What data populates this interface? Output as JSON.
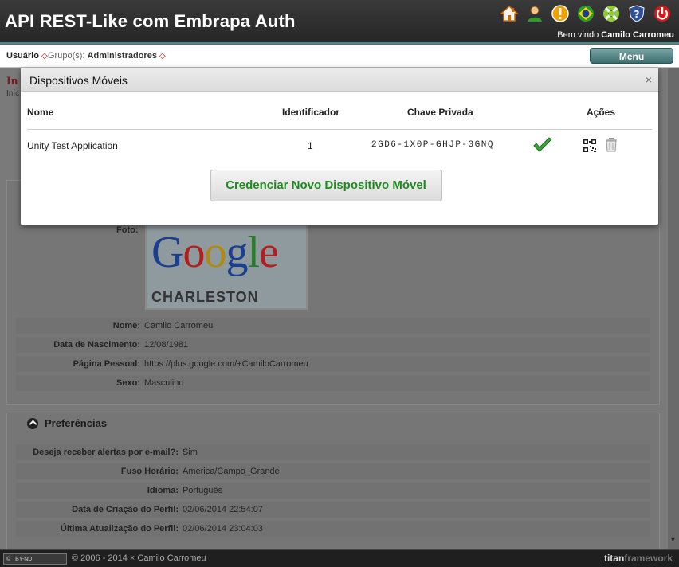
{
  "header": {
    "app_title": "API REST-Like com Embrapa Auth",
    "welcome_prefix": "Bem vindo",
    "welcome_user": "Camilo Carromeu",
    "icons": [
      "home-icon",
      "user-icon",
      "alert-icon",
      "brazil-flag-icon",
      "lifebuoy-icon",
      "help-shield-icon",
      "power-icon"
    ]
  },
  "subbar": {
    "user_label": "Usuário",
    "group_prefix": "Grupo(s):",
    "group_value": "Administradores",
    "menu_label": "Menu"
  },
  "background": {
    "crumb_title": "In",
    "crumb_sub": "Iníc",
    "photo_label": "Foto:",
    "photo_logo_text": "Google",
    "photo_caption": "CHARLESTON ROAD",
    "profile_rows": [
      {
        "label": "Nome:",
        "value": "Camilo Carromeu"
      },
      {
        "label": "Data de Nascimento:",
        "value": "12/08/1981"
      },
      {
        "label": "Página Pessoal:",
        "value": "https://plus.google.com/+CamiloCarromeu"
      },
      {
        "label": "Sexo:",
        "value": "Masculino"
      }
    ],
    "preferences_title": "Preferências",
    "preference_rows": [
      {
        "label": "Deseja receber alertas por e-mail?:",
        "value": "Sim"
      },
      {
        "label": "Fuso Horário:",
        "value": "America/Campo_Grande"
      },
      {
        "label": "Idioma:",
        "value": "Português"
      },
      {
        "label": "Data de Criação do Perfil:",
        "value": "02/06/2014 22:54:07"
      },
      {
        "label": "Última Atualização do Perfil:",
        "value": "02/06/2014 23:04:03"
      }
    ]
  },
  "modal": {
    "title": "Dispositivos Móveis",
    "close_glyph": "×",
    "columns": [
      "Nome",
      "Identificador",
      "Chave Privada",
      "Ações"
    ],
    "rows": [
      {
        "name": "Unity Test Application",
        "id": "1",
        "key": "2GD6-1X0P-GHJP-3GNQ"
      }
    ],
    "new_button": "Credenciar Novo Dispositivo Móvel"
  },
  "footer": {
    "license": "BY-ND",
    "copyright": "© 2006 - 2014 × Camilo Carromeu",
    "brand_a": "titan",
    "brand_b": "framework"
  },
  "colors": {
    "header_bg": "#2e2e2e",
    "accent_teal": "#4b8a8a",
    "button_green_text": "#1e8a1e",
    "crumb_red": "#7a1a1a"
  }
}
